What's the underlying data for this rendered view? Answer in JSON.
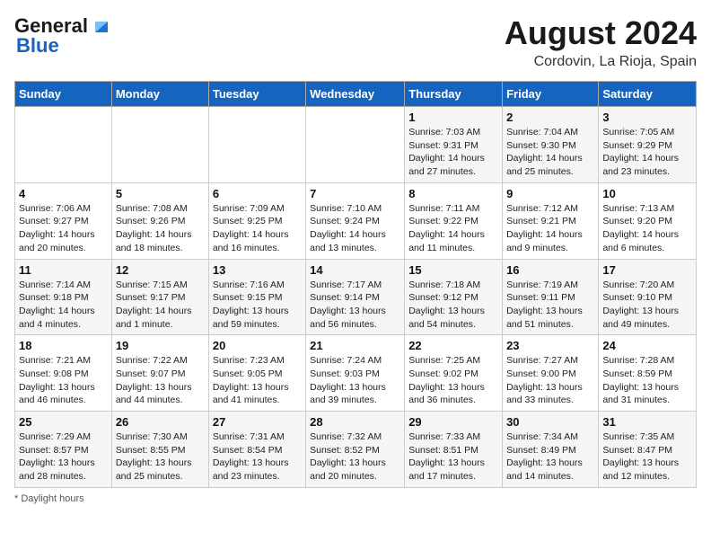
{
  "header": {
    "logo_line1": "General",
    "logo_line2": "Blue",
    "month_year": "August 2024",
    "location": "Cordovin, La Rioja, Spain"
  },
  "days_of_week": [
    "Sunday",
    "Monday",
    "Tuesday",
    "Wednesday",
    "Thursday",
    "Friday",
    "Saturday"
  ],
  "weeks": [
    [
      {
        "day": "",
        "details": ""
      },
      {
        "day": "",
        "details": ""
      },
      {
        "day": "",
        "details": ""
      },
      {
        "day": "",
        "details": ""
      },
      {
        "day": "1",
        "details": "Sunrise: 7:03 AM\nSunset: 9:31 PM\nDaylight: 14 hours and 27 minutes."
      },
      {
        "day": "2",
        "details": "Sunrise: 7:04 AM\nSunset: 9:30 PM\nDaylight: 14 hours and 25 minutes."
      },
      {
        "day": "3",
        "details": "Sunrise: 7:05 AM\nSunset: 9:29 PM\nDaylight: 14 hours and 23 minutes."
      }
    ],
    [
      {
        "day": "4",
        "details": "Sunrise: 7:06 AM\nSunset: 9:27 PM\nDaylight: 14 hours and 20 minutes."
      },
      {
        "day": "5",
        "details": "Sunrise: 7:08 AM\nSunset: 9:26 PM\nDaylight: 14 hours and 18 minutes."
      },
      {
        "day": "6",
        "details": "Sunrise: 7:09 AM\nSunset: 9:25 PM\nDaylight: 14 hours and 16 minutes."
      },
      {
        "day": "7",
        "details": "Sunrise: 7:10 AM\nSunset: 9:24 PM\nDaylight: 14 hours and 13 minutes."
      },
      {
        "day": "8",
        "details": "Sunrise: 7:11 AM\nSunset: 9:22 PM\nDaylight: 14 hours and 11 minutes."
      },
      {
        "day": "9",
        "details": "Sunrise: 7:12 AM\nSunset: 9:21 PM\nDaylight: 14 hours and 9 minutes."
      },
      {
        "day": "10",
        "details": "Sunrise: 7:13 AM\nSunset: 9:20 PM\nDaylight: 14 hours and 6 minutes."
      }
    ],
    [
      {
        "day": "11",
        "details": "Sunrise: 7:14 AM\nSunset: 9:18 PM\nDaylight: 14 hours and 4 minutes."
      },
      {
        "day": "12",
        "details": "Sunrise: 7:15 AM\nSunset: 9:17 PM\nDaylight: 14 hours and 1 minute."
      },
      {
        "day": "13",
        "details": "Sunrise: 7:16 AM\nSunset: 9:15 PM\nDaylight: 13 hours and 59 minutes."
      },
      {
        "day": "14",
        "details": "Sunrise: 7:17 AM\nSunset: 9:14 PM\nDaylight: 13 hours and 56 minutes."
      },
      {
        "day": "15",
        "details": "Sunrise: 7:18 AM\nSunset: 9:12 PM\nDaylight: 13 hours and 54 minutes."
      },
      {
        "day": "16",
        "details": "Sunrise: 7:19 AM\nSunset: 9:11 PM\nDaylight: 13 hours and 51 minutes."
      },
      {
        "day": "17",
        "details": "Sunrise: 7:20 AM\nSunset: 9:10 PM\nDaylight: 13 hours and 49 minutes."
      }
    ],
    [
      {
        "day": "18",
        "details": "Sunrise: 7:21 AM\nSunset: 9:08 PM\nDaylight: 13 hours and 46 minutes."
      },
      {
        "day": "19",
        "details": "Sunrise: 7:22 AM\nSunset: 9:07 PM\nDaylight: 13 hours and 44 minutes."
      },
      {
        "day": "20",
        "details": "Sunrise: 7:23 AM\nSunset: 9:05 PM\nDaylight: 13 hours and 41 minutes."
      },
      {
        "day": "21",
        "details": "Sunrise: 7:24 AM\nSunset: 9:03 PM\nDaylight: 13 hours and 39 minutes."
      },
      {
        "day": "22",
        "details": "Sunrise: 7:25 AM\nSunset: 9:02 PM\nDaylight: 13 hours and 36 minutes."
      },
      {
        "day": "23",
        "details": "Sunrise: 7:27 AM\nSunset: 9:00 PM\nDaylight: 13 hours and 33 minutes."
      },
      {
        "day": "24",
        "details": "Sunrise: 7:28 AM\nSunset: 8:59 PM\nDaylight: 13 hours and 31 minutes."
      }
    ],
    [
      {
        "day": "25",
        "details": "Sunrise: 7:29 AM\nSunset: 8:57 PM\nDaylight: 13 hours and 28 minutes."
      },
      {
        "day": "26",
        "details": "Sunrise: 7:30 AM\nSunset: 8:55 PM\nDaylight: 13 hours and 25 minutes."
      },
      {
        "day": "27",
        "details": "Sunrise: 7:31 AM\nSunset: 8:54 PM\nDaylight: 13 hours and 23 minutes."
      },
      {
        "day": "28",
        "details": "Sunrise: 7:32 AM\nSunset: 8:52 PM\nDaylight: 13 hours and 20 minutes."
      },
      {
        "day": "29",
        "details": "Sunrise: 7:33 AM\nSunset: 8:51 PM\nDaylight: 13 hours and 17 minutes."
      },
      {
        "day": "30",
        "details": "Sunrise: 7:34 AM\nSunset: 8:49 PM\nDaylight: 13 hours and 14 minutes."
      },
      {
        "day": "31",
        "details": "Sunrise: 7:35 AM\nSunset: 8:47 PM\nDaylight: 13 hours and 12 minutes."
      }
    ]
  ],
  "footer": {
    "note": "Daylight hours"
  }
}
